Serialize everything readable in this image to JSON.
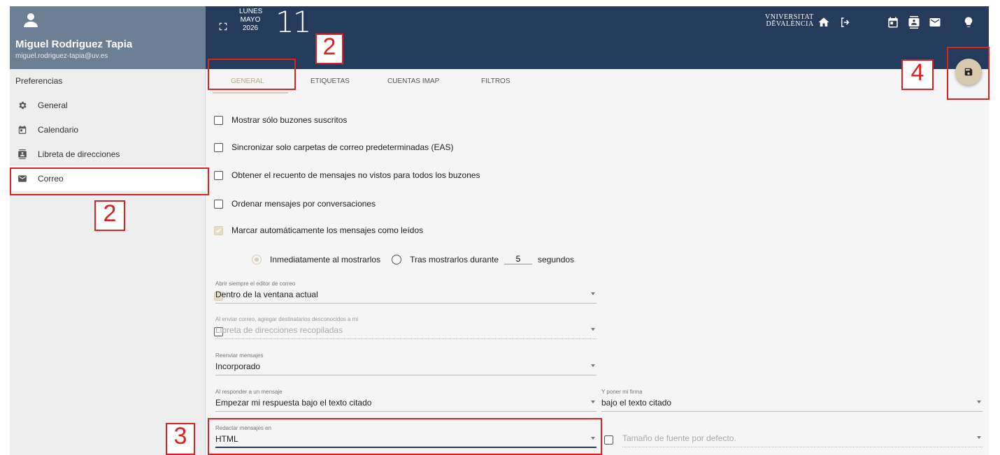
{
  "user": {
    "name": "Miguel Rodriguez Tapia",
    "email": "miguel.rodriguez-tapia@uv.es"
  },
  "sidebar": {
    "section_title": "Preferencias",
    "items": [
      {
        "label": "General",
        "icon": "gear-icon"
      },
      {
        "label": "Calendario",
        "icon": "calendar-icon"
      },
      {
        "label": "Libreta de direcciones",
        "icon": "contacts-icon"
      },
      {
        "label": "Correo",
        "icon": "mail-icon"
      }
    ]
  },
  "topbar": {
    "weekday": "LUNES",
    "month": "MAYO",
    "year": "2026",
    "day": "11",
    "logo_line1": "VNIVERSITAT",
    "logo_line2": "DĒVALÈNCIA"
  },
  "tabs": [
    {
      "label": "General"
    },
    {
      "label": "Etiquetas"
    },
    {
      "label": "Cuentas IMAP"
    },
    {
      "label": "Filtros"
    }
  ],
  "options": {
    "subscribed": "Mostrar sólo buzones suscritos",
    "sync_default": "Sincronizar solo carpetas de correo predeterminadas (EAS)",
    "unseen_count": "Obtener el recuento de mensajes no vistos para todos los buzones",
    "threads": "Ordenar mensajes por conversaciones",
    "auto_read": "Marcar automáticamente los mensajes como leídos",
    "radio_immediate": "Inmediatamente al mostrarlos",
    "radio_after": "Tras mostrarlos durante",
    "seconds_value": "5",
    "seconds_label": "segundos"
  },
  "fields": {
    "editor_label": "Abrir siempre el editor de correo",
    "editor_value": "Dentro de la ventana actual",
    "add_recipients_label": "Al enviar correo, agregar destinatarios desconocidos a mi",
    "add_recipients_value": "Libreta de direcciones recopiladas",
    "forward_label": "Reenviar mensajes",
    "forward_value": "Incorporado",
    "reply_label": "Al responder a un mensaje",
    "reply_value": "Empezar mi respuesta bajo el texto citado",
    "signature_label": "Y poner mi firma",
    "signature_value": "bajo el texto citado",
    "compose_label": "Redactar mensajes en",
    "compose_value": "HTML",
    "font_size_value": "Tamaño de fuente por defecto."
  },
  "annotations": {
    "tab_number": "2",
    "sidebar_number": "2",
    "compose_number": "3",
    "save_number": "4",
    "color": "#e02020"
  },
  "colors": {
    "topbar": "#243b5c",
    "user_box": "#6b7f95",
    "accent": "#d6c9ac"
  }
}
